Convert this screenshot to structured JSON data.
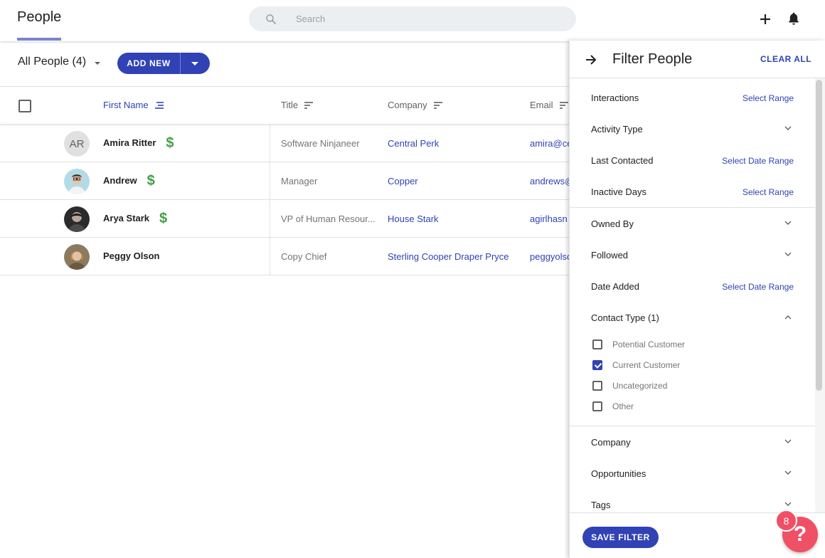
{
  "header": {
    "title": "People",
    "search_placeholder": "Search"
  },
  "toolbar": {
    "view_label": "All People (4)",
    "add_new_label": "ADD NEW"
  },
  "table": {
    "columns": [
      "First Name",
      "Title",
      "Company",
      "Email"
    ],
    "rows": [
      {
        "initials": "AR",
        "name": "Amira Ritter",
        "dollar": "$",
        "title": "Software Ninjaneer",
        "company": "Central Perk",
        "email": "amira@ce"
      },
      {
        "initials": "",
        "name": "Andrew",
        "dollar": "$",
        "title": "Manager",
        "company": "Copper",
        "email": "andrews@"
      },
      {
        "initials": "",
        "name": "Arya Stark",
        "dollar": "$",
        "title": "VP of Human Resour...",
        "company": "House Stark",
        "email": "agirlhasn"
      },
      {
        "initials": "",
        "name": "Peggy Olson",
        "dollar": "",
        "title": "Copy Chief",
        "company": "Sterling Cooper Draper Pryce",
        "email": "peggyolsc"
      }
    ]
  },
  "filter_panel": {
    "title": "Filter People",
    "clear_all": "CLEAR ALL",
    "filters": [
      {
        "label": "Interactions",
        "action": "Select Range"
      },
      {
        "label": "Activity Type",
        "action": ""
      },
      {
        "label": "Last Contacted",
        "action": "Select Date Range"
      },
      {
        "label": "Inactive Days",
        "action": "Select Range"
      },
      {
        "label": "Owned By",
        "action": ""
      },
      {
        "label": "Followed",
        "action": ""
      },
      {
        "label": "Date Added",
        "action": "Select Date Range"
      },
      {
        "label": "Contact Type (1)",
        "action": ""
      },
      {
        "label": "Company",
        "action": ""
      },
      {
        "label": "Opportunities",
        "action": ""
      },
      {
        "label": "Tags",
        "action": ""
      }
    ],
    "contact_type_options": [
      {
        "label": "Potential Customer",
        "checked": false
      },
      {
        "label": "Current Customer",
        "checked": true
      },
      {
        "label": "Uncategorized",
        "checked": false
      },
      {
        "label": "Other",
        "checked": false
      }
    ],
    "save_filter": "SAVE FILTER"
  },
  "help": {
    "badge_count": "8",
    "label": "?"
  },
  "colors": {
    "accent": "#3142b5",
    "money": "#43a047",
    "help": "#ef5066"
  }
}
